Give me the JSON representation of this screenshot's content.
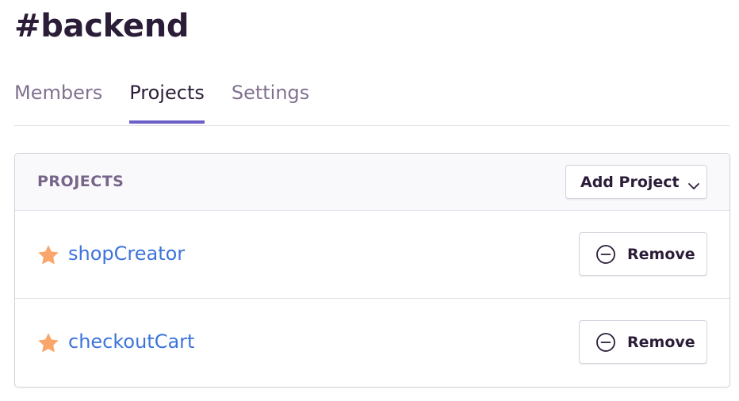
{
  "team": {
    "title": "#backend"
  },
  "tabs": [
    {
      "label": "Members",
      "active": false
    },
    {
      "label": "Projects",
      "active": true
    },
    {
      "label": "Settings",
      "active": false
    }
  ],
  "projects_panel": {
    "header_label": "PROJECTS",
    "add_project_label": "Add Project",
    "add_project_icon": "chevron-down-icon",
    "items": [
      {
        "name": "shopCreator",
        "starred": true,
        "remove_label": "Remove",
        "remove_icon": "minus-circle-icon"
      },
      {
        "name": "checkoutCart",
        "starred": true,
        "remove_label": "Remove",
        "remove_icon": "minus-circle-icon"
      }
    ]
  },
  "colors": {
    "accent": "#6c5fc7",
    "link": "#3d74db",
    "star": "#f9a66d",
    "heading": "#2b1d38",
    "muted": "#80708f"
  }
}
